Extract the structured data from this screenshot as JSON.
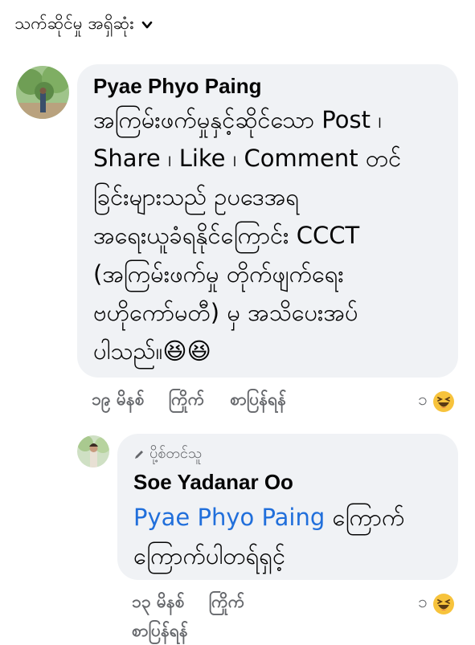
{
  "sort": {
    "label": "သက်ဆိုင်မှု အရှိဆုံး"
  },
  "comments": [
    {
      "author": "Pyae Phyo Paing",
      "text": "အကြမ်းဖက်မှုနှင့်ဆိုင်သော Post ၊\nShare ၊ Like ၊ Comment တင်\nခြင်းများသည် ဥပဒေအရ\nအရေးယူခံရနိုင်ကြောင်း CCCT\n(အကြမ်းဖက်မှု တိုက်ဖျက်ရေး\nဗဟိုကော်မတီ) မှ အသိပေးအပ်\nပါသည်။😆😆",
      "time": "၁၉ မိနစ်",
      "like": "ကြိုက်",
      "reply": "စာပြန်ရန်",
      "reaction_count": "၁"
    },
    {
      "badge": "ပို့စ်တင်သူ",
      "author": "Soe Yadanar Oo",
      "mention": "Pyae Phyo Paing",
      "text_after_mention": " ကြောက်\nကြောက်ပါတရ်ရှင့်",
      "time": "၁၃ မိနစ်",
      "like": "ကြိုက်",
      "reply": "စာပြန်ရန်",
      "reaction_count": "၁"
    }
  ],
  "colors": {
    "bubble": "#f0f2f5",
    "mention": "#216fdb",
    "meta": "#65676b"
  }
}
